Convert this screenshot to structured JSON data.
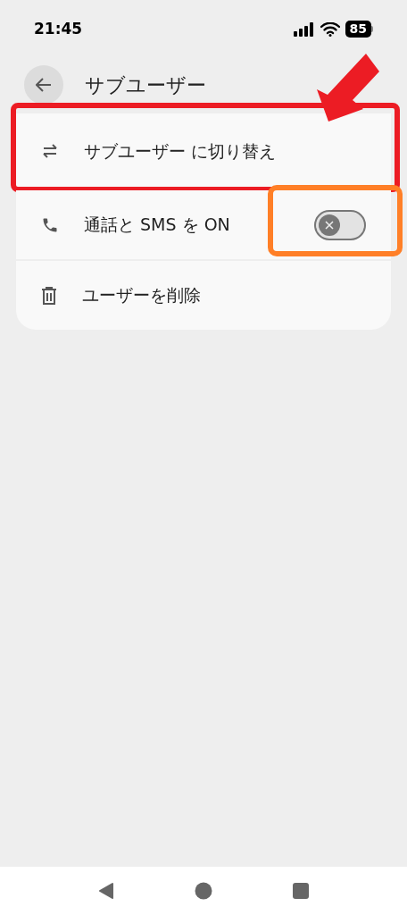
{
  "status_bar": {
    "time": "21:45",
    "battery": "85"
  },
  "header": {
    "title": "サブユーザー"
  },
  "items": [
    {
      "kind": "action",
      "label": "サブユーザー に切り替え",
      "color": "#ec1c24"
    },
    {
      "kind": "toggle",
      "label": "通話と SMS を ON",
      "on": false,
      "color": "#ff7f27"
    },
    {
      "kind": "action",
      "label": "ユーザーを削除"
    }
  ],
  "annotations": [
    {
      "kind": "arrow",
      "color": "#ec1c24"
    }
  ]
}
